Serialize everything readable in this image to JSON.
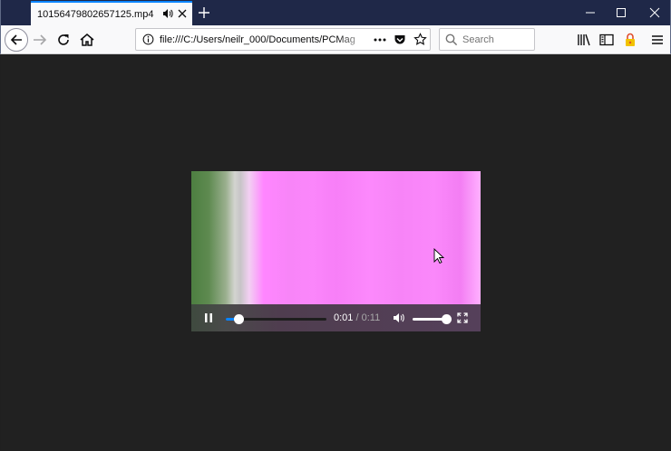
{
  "tab": {
    "title": "10156479802657125.mp4",
    "audio_icon": "speaker-icon",
    "close_icon": "close-icon"
  },
  "new_tab_icon": "plus-icon",
  "window_controls": [
    "minimize-icon",
    "maximize-icon",
    "close-icon"
  ],
  "nav": {
    "back_icon": "arrow-left-icon",
    "forward_icon": "arrow-right-icon",
    "reload_icon": "reload-icon",
    "home_icon": "home-icon"
  },
  "urlbar": {
    "info_icon": "info-icon",
    "url": "file:///C:/Users/neilr_000/Documents/PCMag",
    "actions": [
      "more-icon",
      "pocket-icon",
      "star-icon"
    ]
  },
  "searchbar": {
    "placeholder": "Search"
  },
  "toolbar_right": [
    "library-icon",
    "sidebar-icon",
    "lock-icon",
    "menu-icon"
  ],
  "video": {
    "current_time": "0:01",
    "separator": " / ",
    "total_time": "0:11",
    "progress_fraction": 0.11,
    "volume_fraction": 1.0,
    "accent_color": "#0a84ff",
    "frame_colors": [
      "#4d7f41",
      "#ff86ff"
    ]
  }
}
